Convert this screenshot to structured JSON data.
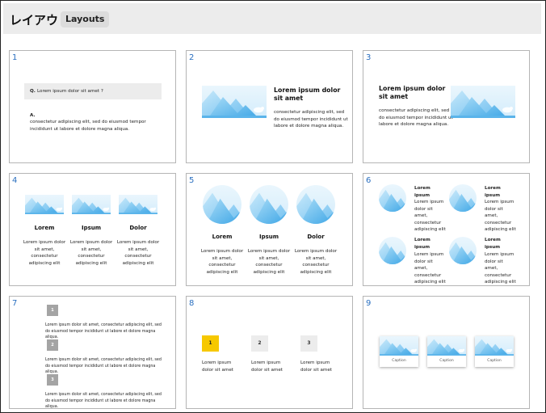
{
  "header": {
    "title": "レイアウト",
    "badge": "Layouts"
  },
  "cards": [
    {
      "num": "1",
      "q_label": "Q.",
      "q_text": "Lorem ipsum dolor sit amet ?",
      "a_label": "A.",
      "a_text": "consectetur adipiscing elit, sed do eiusmod tempor incididunt ut labore et dolore magna aliqua."
    },
    {
      "num": "2",
      "heading": "Lorem ipsum dolor sit amet",
      "body": "consectetur adipiscing elit, sed do eiusmod tempor incididunt ut labore et dolore magna aliqua."
    },
    {
      "num": "3",
      "heading": "Lorem ipsum dolor sit amet",
      "body": "consectetur adipiscing elit, sed do eiusmod tempor incididunt ut labore et dolore magna aliqua."
    },
    {
      "num": "4",
      "cols": [
        {
          "title": "Lorem",
          "body": "Lorem ipsum dolor sit amet, consectetur adipiscing elit"
        },
        {
          "title": "Ipsum",
          "body": "Lorem ipsum dolor sit amet, consectetur adipiscing elit"
        },
        {
          "title": "Dolor",
          "body": "Lorem ipsum dolor sit amet, consectetur adipiscing elit"
        }
      ]
    },
    {
      "num": "5",
      "cols": [
        {
          "title": "Lorem",
          "body": "Lorem ipsum dolor sit amet, consectetur adipiscing elit"
        },
        {
          "title": "Ipsum",
          "body": "Lorem ipsum dolor sit amet, consectetur adipiscing elit"
        },
        {
          "title": "Dolor",
          "body": "Lorem ipsum dolor sit amet, consectetur adipiscing elit"
        }
      ]
    },
    {
      "num": "6",
      "items": [
        {
          "title": "Lorem ipsum",
          "body": "Lorem ipsum dolor sit amet, consectetur adipiscing elit"
        },
        {
          "title": "Lorem ipsum",
          "body": "Lorem ipsum dolor sit amet, consectetur adipiscing elit"
        },
        {
          "title": "Lorem ipsum",
          "body": "Lorem ipsum dolor sit amet, consectetur adipiscing elit"
        },
        {
          "title": "Lorem ipsum",
          "body": "Lorem ipsum dolor sit amet, consectetur adipiscing elit"
        }
      ]
    },
    {
      "num": "7",
      "steps": [
        {
          "n": "1",
          "text": "Lorem ipsum dolor sit amet, consectetur adipiscing elit, sed do eiusmod tempor incididunt ut labore et dolore magna aliqua."
        },
        {
          "n": "2",
          "text": "Lorem ipsum dolor sit amet, consectetur adipiscing elit, sed do eiusmod tempor incididunt ut labore et dolore magna aliqua."
        },
        {
          "n": "3",
          "text": "Lorem ipsum dolor sit amet, consectetur adipiscing elit, sed do eiusmod tempor incididunt ut labore et dolore magna aliqua."
        }
      ]
    },
    {
      "num": "8",
      "tabs": [
        {
          "n": "1",
          "text": "Lorem ipsum dolor sit amet"
        },
        {
          "n": "2",
          "text": "Lorem ipsum dolor sit amet"
        },
        {
          "n": "3",
          "text": "Lorem ipsum dolor sit amet"
        }
      ]
    },
    {
      "num": "9",
      "captions": [
        "Caption",
        "Caption",
        "Caption"
      ]
    }
  ],
  "colors": {
    "accent_number": "#2a6fc0",
    "active_tab": "#f6c800",
    "image_light": "#d8eefb",
    "image_dark": "#58b3ea"
  },
  "icons": {
    "placeholder": "mountain-bear-image"
  }
}
